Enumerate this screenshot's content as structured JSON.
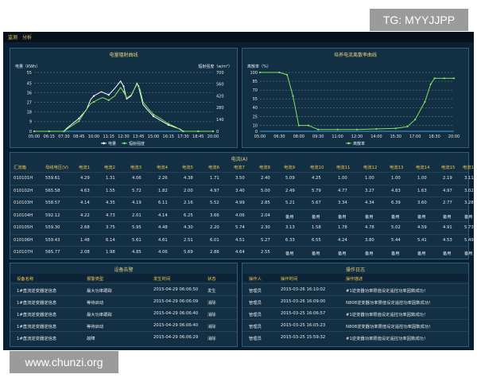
{
  "watermark_top": "TG: MYYJJPP",
  "watermark_bottom": "www.chunzi.org",
  "nav": {
    "item1": "监测",
    "item2": "分析"
  },
  "chart1": {
    "title": "电量辐射曲线",
    "yleft_label": "电量（KWh）",
    "yright_label": "辐射强度（w/m²）",
    "legend": [
      "电量",
      "辐射强度"
    ]
  },
  "chart2": {
    "title": "培养电流离散率曲线",
    "yleft_label": "离散率（%）",
    "legend": [
      "离散率"
    ]
  },
  "colors": {
    "series_a": "#7fe35c",
    "series_b": "#ffffff",
    "header_gold": "#f2c94c",
    "title_yellow": "#e6d27a"
  },
  "chart_data": [
    {
      "type": "line",
      "title": "电量辐射曲线",
      "xlabel": "",
      "ylabel": "电量（KWh）",
      "y2label": "辐射强度（w/m²）",
      "ylim": [
        0,
        55
      ],
      "y2lim": [
        0,
        700
      ],
      "yticks": [
        0,
        9,
        18,
        27,
        36,
        45,
        55
      ],
      "y2ticks": [
        0,
        140,
        280,
        420,
        560,
        700
      ],
      "x": [
        "05:00",
        "06:15",
        "07:30",
        "08:45",
        "10:00",
        "11:15",
        "12:30",
        "13:45",
        "15:00",
        "16:15",
        "17:30",
        "18:45",
        "20:00"
      ],
      "series": [
        {
          "name": "电量",
          "axis": "left",
          "points": [
            [
              0,
              0
            ],
            [
              1,
              0
            ],
            [
              2,
              0
            ],
            [
              2.2,
              3
            ],
            [
              3,
              12
            ],
            [
              3.5,
              20
            ],
            [
              3.8,
              30
            ],
            [
              4,
              33
            ],
            [
              4.5,
              37
            ],
            [
              5,
              34
            ],
            [
              5.4,
              40
            ],
            [
              5.8,
              47
            ],
            [
              6,
              42
            ],
            [
              6.2,
              30
            ],
            [
              6.5,
              33
            ],
            [
              6.9,
              45
            ],
            [
              7,
              42
            ],
            [
              7.3,
              25
            ],
            [
              7.6,
              20
            ],
            [
              8,
              14
            ],
            [
              8.5,
              10
            ],
            [
              9,
              6
            ],
            [
              9.4,
              4
            ],
            [
              9.8,
              2
            ],
            [
              10,
              0
            ],
            [
              11,
              0
            ],
            [
              12,
              0
            ]
          ]
        },
        {
          "name": "辐射强度",
          "axis": "right",
          "points": [
            [
              0,
              0
            ],
            [
              1,
              0
            ],
            [
              2,
              0
            ],
            [
              2.3,
              40
            ],
            [
              3,
              120
            ],
            [
              3.5,
              260
            ],
            [
              3.8,
              330
            ],
            [
              4,
              350
            ],
            [
              4.3,
              380
            ],
            [
              4.6,
              400
            ],
            [
              5,
              370
            ],
            [
              5.4,
              420
            ],
            [
              5.8,
              520
            ],
            [
              6,
              470
            ],
            [
              6.2,
              400
            ],
            [
              6.5,
              430
            ],
            [
              6.9,
              560
            ],
            [
              7.1,
              500
            ],
            [
              7.3,
              350
            ],
            [
              7.7,
              260
            ],
            [
              8,
              200
            ],
            [
              8.5,
              150
            ],
            [
              9,
              90
            ],
            [
              9.5,
              50
            ],
            [
              10,
              0
            ],
            [
              11,
              0
            ],
            [
              12,
              0
            ]
          ]
        }
      ],
      "legend_position": "bottom-center",
      "grid": true
    },
    {
      "type": "line",
      "title": "培养电流离散率曲线",
      "xlabel": "",
      "ylabel": "离散率（%）",
      "ylim": [
        0,
        100
      ],
      "yticks": [
        0,
        10,
        25,
        40,
        55,
        70,
        85,
        100
      ],
      "x": [
        "05:00",
        "06:30",
        "08:00",
        "09:30",
        "11:00",
        "12:30",
        "14:00",
        "15:30",
        "17:00",
        "18:30",
        "20:00"
      ],
      "series": [
        {
          "name": "离散率",
          "points": [
            [
              0,
              100
            ],
            [
              1,
              100
            ],
            [
              1.4,
              96
            ],
            [
              1.7,
              60
            ],
            [
              2,
              10
            ],
            [
              2.5,
              10
            ],
            [
              3,
              3
            ],
            [
              4,
              3
            ],
            [
              5,
              3
            ],
            [
              6,
              4
            ],
            [
              7,
              5
            ],
            [
              7.6,
              8
            ],
            [
              8,
              20
            ],
            [
              8.5,
              50
            ],
            [
              8.8,
              80
            ],
            [
              9,
              90
            ],
            [
              9.5,
              90
            ],
            [
              10,
              90
            ]
          ]
        }
      ],
      "legend_position": "bottom-center",
      "grid": true
    }
  ],
  "table": {
    "title": "电流(A)",
    "headers": [
      "汇流箱",
      "母线电压(V)",
      "电流1",
      "电流2",
      "电流3",
      "电流4",
      "电流5",
      "电流6",
      "电流7",
      "电流8",
      "电流9",
      "电流10",
      "电流11",
      "电流12",
      "电流13",
      "电流14",
      "电流15",
      "电流16"
    ],
    "rows": [
      [
        "010101H",
        "559.61",
        "4.29",
        "1.31",
        "4.06",
        "2.26",
        "4.38",
        "1.71",
        "3.50",
        "2.40",
        "5.09",
        "4.25",
        "1.00",
        "1.00",
        "1.00",
        "1.00",
        "2.19",
        "3.11"
      ],
      [
        "010102H",
        "565.58",
        "4.63",
        "1.55",
        "5.72",
        "1.82",
        "2.00",
        "4.97",
        "3.40",
        "5.00",
        "2.49",
        "5.79",
        "4.77",
        "3.27",
        "4.83",
        "1.63",
        "4.97",
        "3.02"
      ],
      [
        "010103H",
        "558.57",
        "4.14",
        "4.35",
        "4.19",
        "6.11",
        "2.16",
        "5.52",
        "4.99",
        "2.85",
        "5.21",
        "5.67",
        "3.34",
        "4.34",
        "6.39",
        "3.60",
        "2.77",
        "3.28"
      ],
      [
        "010104H",
        "592.12",
        "4.22",
        "4.73",
        "2.01",
        "4.14",
        "6.25",
        "3.66",
        "4.06",
        "2.04",
        "备用",
        "备用",
        "备用",
        "备用",
        "备用",
        "备用",
        "备用",
        "备用"
      ],
      [
        "010105H",
        "559.30",
        "2.68",
        "3.75",
        "5.95",
        "4.48",
        "4.30",
        "2.20",
        "5.74",
        "2.30",
        "3.13",
        "1.58",
        "1.78",
        "4.78",
        "5.02",
        "4.59",
        "4.91",
        "5.73"
      ],
      [
        "010106H",
        "559.43",
        "1.48",
        "6.14",
        "5.61",
        "4.61",
        "2.51",
        "6.01",
        "4.51",
        "5.27",
        "6.33",
        "6.55",
        "4.24",
        "3.80",
        "5.44",
        "5.41",
        "4.53",
        "5.49"
      ],
      [
        "010107H",
        "565.77",
        "2.08",
        "1.98",
        "4.85",
        "4.06",
        "5.69",
        "2.86",
        "4.64",
        "2.55",
        "备用",
        "备用",
        "备用",
        "备用",
        "备用",
        "备用",
        "备用",
        "备用"
      ]
    ]
  },
  "alarms": {
    "title": "设备告警",
    "headers": [
      "设备名称",
      "报警类型",
      "发生时间",
      "状态"
    ],
    "rows": [
      [
        "1#直流逆变器逆信息",
        "最大功率跟踪",
        "2015-04-29 06:06:50",
        "发生"
      ],
      [
        "1#直流逆变器逆信息",
        "等待启动",
        "2015-04-29 06:06:09",
        "消除"
      ],
      [
        "1#直流逆变器逆信息",
        "最大功率跟踪",
        "2015-04-29 06:06:40",
        "消除"
      ],
      [
        "1#直流逆变器逆信息",
        "等待启动",
        "2015-04-29 06:06:40",
        "消除"
      ],
      [
        "1#直流逆变器逆信息",
        "故障",
        "2015-04-29 06:06:29",
        "消除"
      ]
    ]
  },
  "logs": {
    "title": "操作日志",
    "headers": [
      "操作人",
      "操作时间",
      "操作描述"
    ],
    "rows": [
      [
        "管理员",
        "2015-03-26 16:10:02",
        "#1逆变器功率限值设定遥控功率因数成功！"
      ],
      [
        "管理员",
        "2015-03-26 16:09:00",
        "N808逆变器功率限值设定遥控功率因数成功！"
      ],
      [
        "管理员",
        "2015-03-25 16:06:57",
        "#1逆变器功率限值设定遥控功率因数成功！"
      ],
      [
        "管理员",
        "2015-03-25 16:05:23",
        "N808逆变器功率限值设定遥控功率因数成功！"
      ],
      [
        "管理员",
        "2015-03-25 15:59:32",
        "#1逆变器功率限值设定遥控功率因数成功！"
      ]
    ]
  }
}
